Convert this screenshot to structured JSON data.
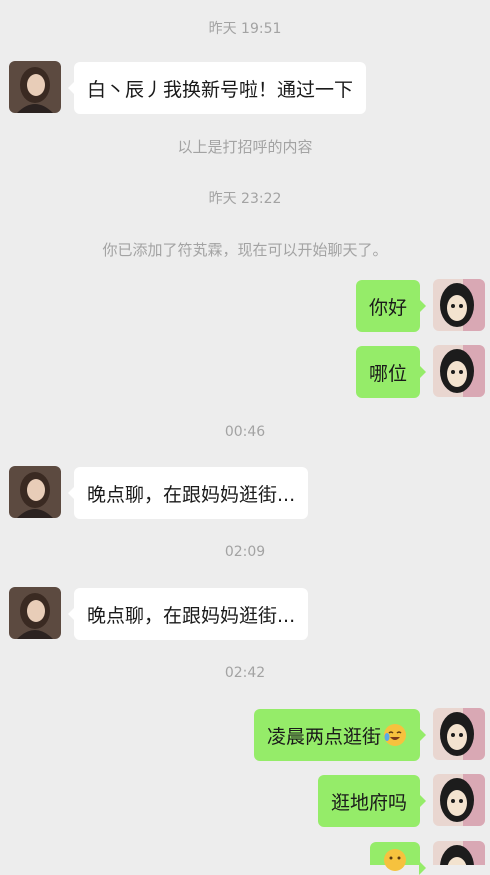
{
  "colors": {
    "background": "#ededed",
    "bubble_self": "#95ec69",
    "bubble_other": "#ffffff",
    "system_text": "#a3a3a3"
  },
  "messages": [
    {
      "type": "time",
      "text": "昨天 19:51"
    },
    {
      "type": "incoming",
      "text": "白丶辰丿我换新号啦！通过一下"
    },
    {
      "type": "system",
      "text": "以上是打招呼的内容"
    },
    {
      "type": "time",
      "text": "昨天 23:22"
    },
    {
      "type": "system",
      "text": "你已添加了符芄霖，现在可以开始聊天了。"
    },
    {
      "type": "outgoing",
      "text": "你好"
    },
    {
      "type": "outgoing",
      "text": "哪位"
    },
    {
      "type": "time",
      "text": "00:46"
    },
    {
      "type": "incoming",
      "text": "晚点聊，在跟妈妈逛街..."
    },
    {
      "type": "time",
      "text": "02:09"
    },
    {
      "type": "incoming",
      "text": "晚点聊，在跟妈妈逛街..."
    },
    {
      "type": "time",
      "text": "02:42"
    },
    {
      "type": "outgoing",
      "text": "凌晨两点逛街",
      "emoji": "laughing-crying-emoji"
    },
    {
      "type": "outgoing",
      "text": "逛地府吗"
    },
    {
      "type": "outgoing",
      "text": "",
      "emoji": "face-emoji"
    }
  ]
}
